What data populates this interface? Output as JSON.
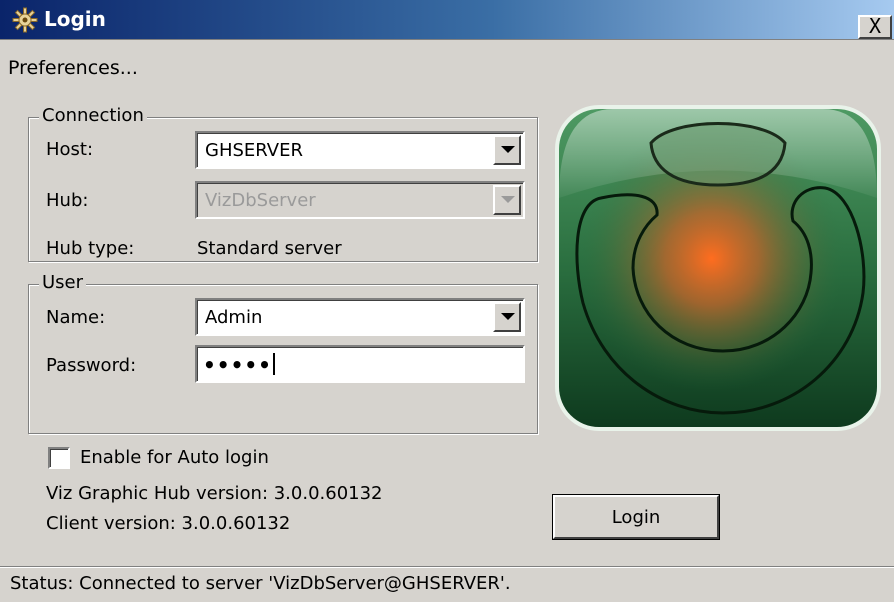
{
  "window": {
    "title": "Login",
    "close_label": "X"
  },
  "menu": {
    "preferences": "Preferences..."
  },
  "connection": {
    "legend": "Connection",
    "host_label": "Host:",
    "host_value": "GHSERVER",
    "hub_label": "Hub:",
    "hub_value": "VizDbServer",
    "hub_type_label": "Hub type:",
    "hub_type_value": "Standard server"
  },
  "user": {
    "legend": "User",
    "name_label": "Name:",
    "name_value": "Admin",
    "password_label": "Password:",
    "password_value": "•••••"
  },
  "options": {
    "auto_login_label": "Enable for Auto login",
    "auto_login_checked": false
  },
  "versions": {
    "hub_version": "Viz Graphic Hub version: 3.0.0.60132",
    "client_version": "Client version: 3.0.0.60132"
  },
  "actions": {
    "login_label": "Login"
  },
  "status": {
    "text": "Status: Connected to server 'VizDbServer@GHSERVER'."
  },
  "icons": {
    "title": "gear-icon",
    "logo": "viz-graphic-hub-logo"
  },
  "colors": {
    "titlebar": "#0a246a",
    "logo_green": "#1f6a34",
    "logo_glow": "#ff6a1a"
  }
}
